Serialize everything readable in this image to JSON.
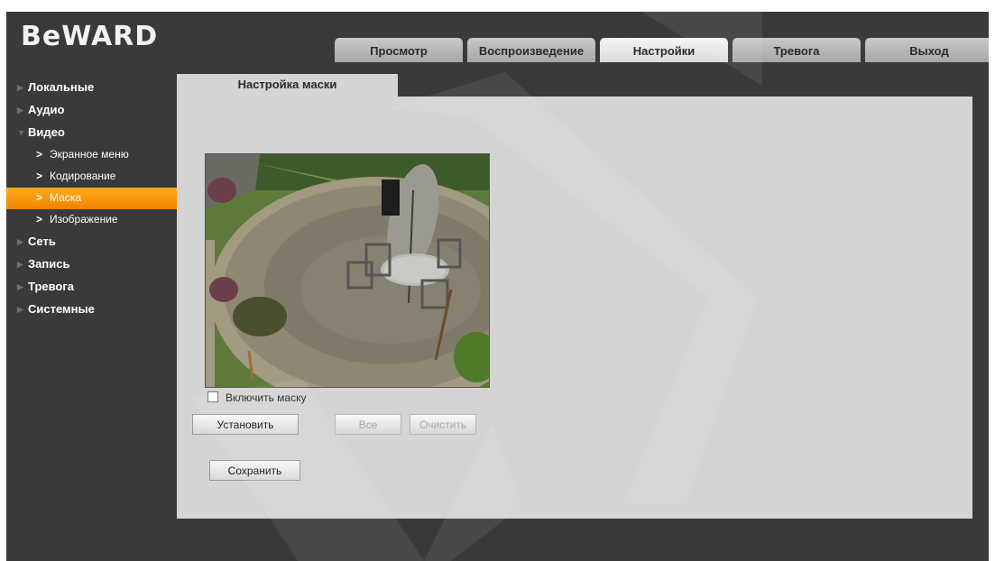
{
  "brand": {
    "logo": "BeWARD"
  },
  "topnav": {
    "tabs": [
      {
        "label": "Просмотр",
        "active": false
      },
      {
        "label": "Воспроизведение",
        "active": false
      },
      {
        "label": "Настройки",
        "active": true
      },
      {
        "label": "Тревога",
        "active": false
      },
      {
        "label": "Выход",
        "active": false
      }
    ]
  },
  "sidebar": {
    "items": [
      {
        "label": "Локальные"
      },
      {
        "label": "Аудио"
      },
      {
        "label": "Видео",
        "expanded": true,
        "children": [
          {
            "label": "Экранное меню"
          },
          {
            "label": "Кодирование"
          },
          {
            "label": "Маска",
            "active": true
          },
          {
            "label": "Изображение"
          }
        ]
      },
      {
        "label": "Сеть"
      },
      {
        "label": "Запись"
      },
      {
        "label": "Тревога"
      },
      {
        "label": "Системные"
      }
    ]
  },
  "panel": {
    "title": "Настройка маски",
    "enable_mask_label": "Включить маску",
    "enable_mask_checked": false,
    "buttons": {
      "set": "Установить",
      "all": "Все",
      "clear": "Очистить",
      "save": "Сохранить"
    }
  },
  "colors": {
    "frame_bg": "#3a3a3a",
    "panel_bg": "#d4d4d4",
    "accent": "#f08300"
  },
  "icons": {
    "collapsed": "triangle-right-icon",
    "expanded": "triangle-down-icon",
    "sub": "chevron-right-icon"
  }
}
